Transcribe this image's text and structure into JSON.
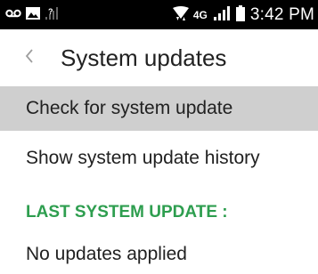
{
  "status_bar": {
    "time": "3:42 PM",
    "network_type": "4G",
    "icons": [
      "voicemail-icon",
      "image-notification-icon",
      "no-sim-signal-icon",
      "wifi-data-icon",
      "signal-icon",
      "battery-icon"
    ]
  },
  "app_bar": {
    "back_icon": "chevron-left-icon",
    "title": "System updates"
  },
  "list": {
    "check_update": "Check for system update",
    "show_history": "Show system update history"
  },
  "section": {
    "header": "LAST SYSTEM UPDATE :",
    "value": "No updates applied"
  },
  "colors": {
    "status_bar_bg": "#000000",
    "highlight_row": "#cfcfcf",
    "section_header": "#2e9e4f"
  }
}
